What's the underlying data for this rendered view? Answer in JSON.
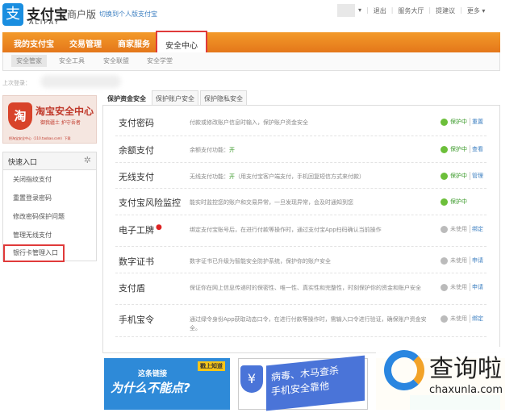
{
  "header": {
    "logo_icon": "支",
    "logo_text": "支付宝",
    "logo_sub": "ALIPAY",
    "edition": "商户版",
    "switch_link": "切换到个人版支付宝",
    "links": [
      "退出",
      "服务大厅",
      "提建议",
      "更多"
    ]
  },
  "nav": {
    "items": [
      "我的支付宝",
      "交易管理",
      "商家服务"
    ],
    "active": "安全中心"
  },
  "subnav": {
    "items": [
      "安全管家",
      "安全工具",
      "安全联盟",
      "安全学堂"
    ]
  },
  "last_login": "上次登录：",
  "banner": {
    "title": "淘宝安全中心",
    "subtitle": "御我疆土 护守吾者",
    "footer": "把淘宝安全中心（110.taobao.com）下载",
    "icon": "淘"
  },
  "quick": {
    "title": "快速入口",
    "items": [
      "关闭指纹支付",
      "重置登录密码",
      "修改密码保护问题",
      "管理无线支付",
      "银行卡管理入口"
    ]
  },
  "tabs": [
    "保护资金安全",
    "保护账户安全",
    "保护隐私安全"
  ],
  "rows": [
    {
      "name": "支付密码",
      "desc": "付款或修改账户信息时输入，保护账户资金安全",
      "status": "保护中",
      "action": "重置",
      "active": true
    },
    {
      "name": "余额支付",
      "desc": "余额支付功能：",
      "on": "开",
      "status": "保护中",
      "action": "查看",
      "active": true
    },
    {
      "name": "无线支付",
      "desc": "无线支付功能：",
      "on": "开",
      "desc2": "（用支付宝客户端支付，手机回复短信方式来付款）",
      "status": "保护中",
      "action": "管理",
      "active": true
    },
    {
      "name": "支付宝风险监控",
      "desc": "能实时监控您的账户和交易异常，一旦发现异常，会及时通知到您",
      "status": "保护中",
      "active": true
    },
    {
      "name": "电子工牌",
      "desc": "绑定支付宝账号后，在进行付款等操作时，通过支付宝App扫码确认当前操作",
      "status": "未使用",
      "action": "绑定",
      "active": false
    },
    {
      "name": "数字证书",
      "desc": "数字证书已升级为智能安全防护系统，保护你的账户安全",
      "status": "未使用",
      "action": "申请",
      "active": false
    },
    {
      "name": "支付盾",
      "desc": "保证你在网上信息传递时的保密性、唯一性、真实性和完整性，时刻保护你的资金和账户安全",
      "status": "未使用",
      "action": "申请",
      "active": false
    },
    {
      "name": "手机宝令",
      "desc": "通过绿令身份App获取动态口令，在进行付款等操作时，需输入口令进行验证，确保账户资金安全。",
      "status": "未使用",
      "action": "绑定",
      "active": false
    }
  ],
  "ads": {
    "ad1_top": "这条链接",
    "ad1_main": "为什么不能点?",
    "ad1_badge": "戳上知道",
    "ad2_line1": "病毒、木马查杀",
    "ad2_line2": "手机安全靠他"
  },
  "watermark": {
    "cn": "查询啦",
    "en": "chaxunla.com"
  },
  "colors": {
    "orange": "#e98a22",
    "green": "#6cbf3a",
    "gray": "#bbbbbb",
    "link": "#3c7fc1"
  }
}
